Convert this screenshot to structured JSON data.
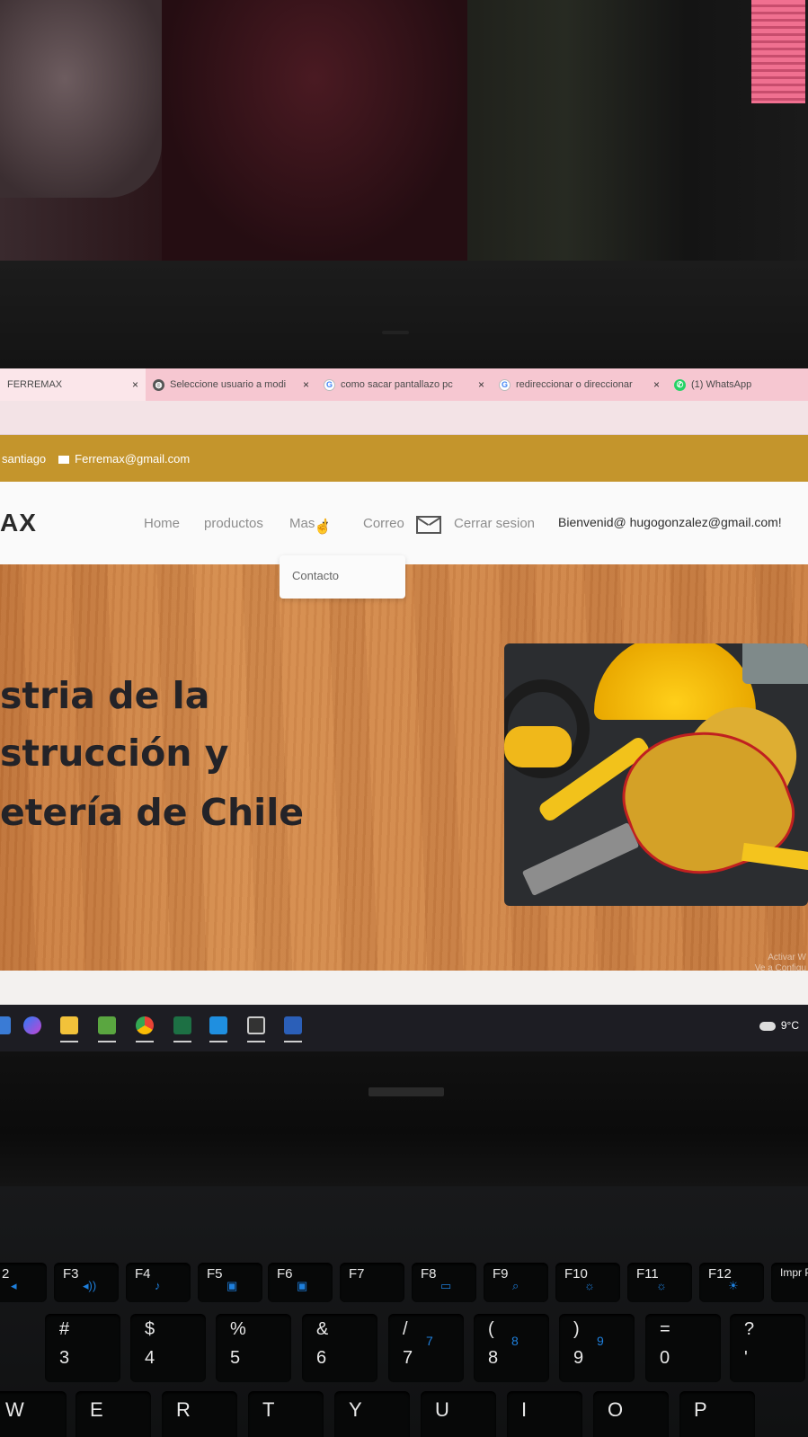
{
  "browser": {
    "tabs": [
      {
        "title": "FERREMAX",
        "favicon": "none",
        "active": true
      },
      {
        "title": "Seleccione usuario a modi",
        "favicon": "globe-icon",
        "active": false
      },
      {
        "title": "como sacar pantallazo pc",
        "favicon": "google-icon",
        "active": false
      },
      {
        "title": "redireccionar o direccionar",
        "favicon": "google-icon",
        "active": false
      },
      {
        "title": "(1) WhatsApp",
        "favicon": "whatsapp-icon",
        "active": false
      }
    ],
    "close_glyph": "×"
  },
  "site": {
    "topstrip": {
      "location": "santiago",
      "email": "Ferremax@gmail.com",
      "color": "#c4952c"
    },
    "brand": "AX",
    "nav": {
      "home": "Home",
      "productos": "productos",
      "mas": "Mas",
      "correo": "Correo",
      "cerrar_sesion": "Cerrar sesion",
      "welcome": "Bienvenid@ hugogonzalez@gmail.com!"
    },
    "dropdown": {
      "items": [
        "Contacto"
      ]
    },
    "hero": {
      "lines": [
        "stria de la",
        "strucción y",
        "etería de Chile"
      ],
      "background_color": "#cf8346",
      "image_description_icon": "tools-photo"
    },
    "watermark": [
      "Activar W",
      "Ve a Configu"
    ]
  },
  "taskbar": {
    "apps": [
      "copilot-icon",
      "file-explorer-icon",
      "store-icon",
      "chrome-icon",
      "excel-icon",
      "vscode-icon",
      "terminal-icon",
      "word-icon"
    ],
    "weather": "9°C"
  },
  "keyboard": {
    "function_keys": [
      "2",
      "F3",
      "F4",
      "F5",
      "F6",
      "F7",
      "F8",
      "F9",
      "F10",
      "F11",
      "F12",
      "Impr P"
    ],
    "number_keys": [
      {
        "top": "#",
        "bottom": "3",
        "sub": ""
      },
      {
        "top": "$",
        "bottom": "4",
        "sub": ""
      },
      {
        "top": "%",
        "bottom": "5",
        "sub": ""
      },
      {
        "top": "&",
        "bottom": "6",
        "sub": ""
      },
      {
        "top": "/",
        "bottom": "7",
        "sub": "7"
      },
      {
        "top": "(",
        "bottom": "8",
        "sub": "8"
      },
      {
        "top": ")",
        "bottom": "9",
        "sub": "9"
      },
      {
        "top": "=",
        "bottom": "0",
        "sub": ""
      },
      {
        "top": "?",
        "bottom": "'",
        "sub": ""
      }
    ],
    "letter_keys": [
      "W",
      "E",
      "R",
      "T",
      "Y",
      "U",
      "I",
      "O",
      "P"
    ]
  }
}
